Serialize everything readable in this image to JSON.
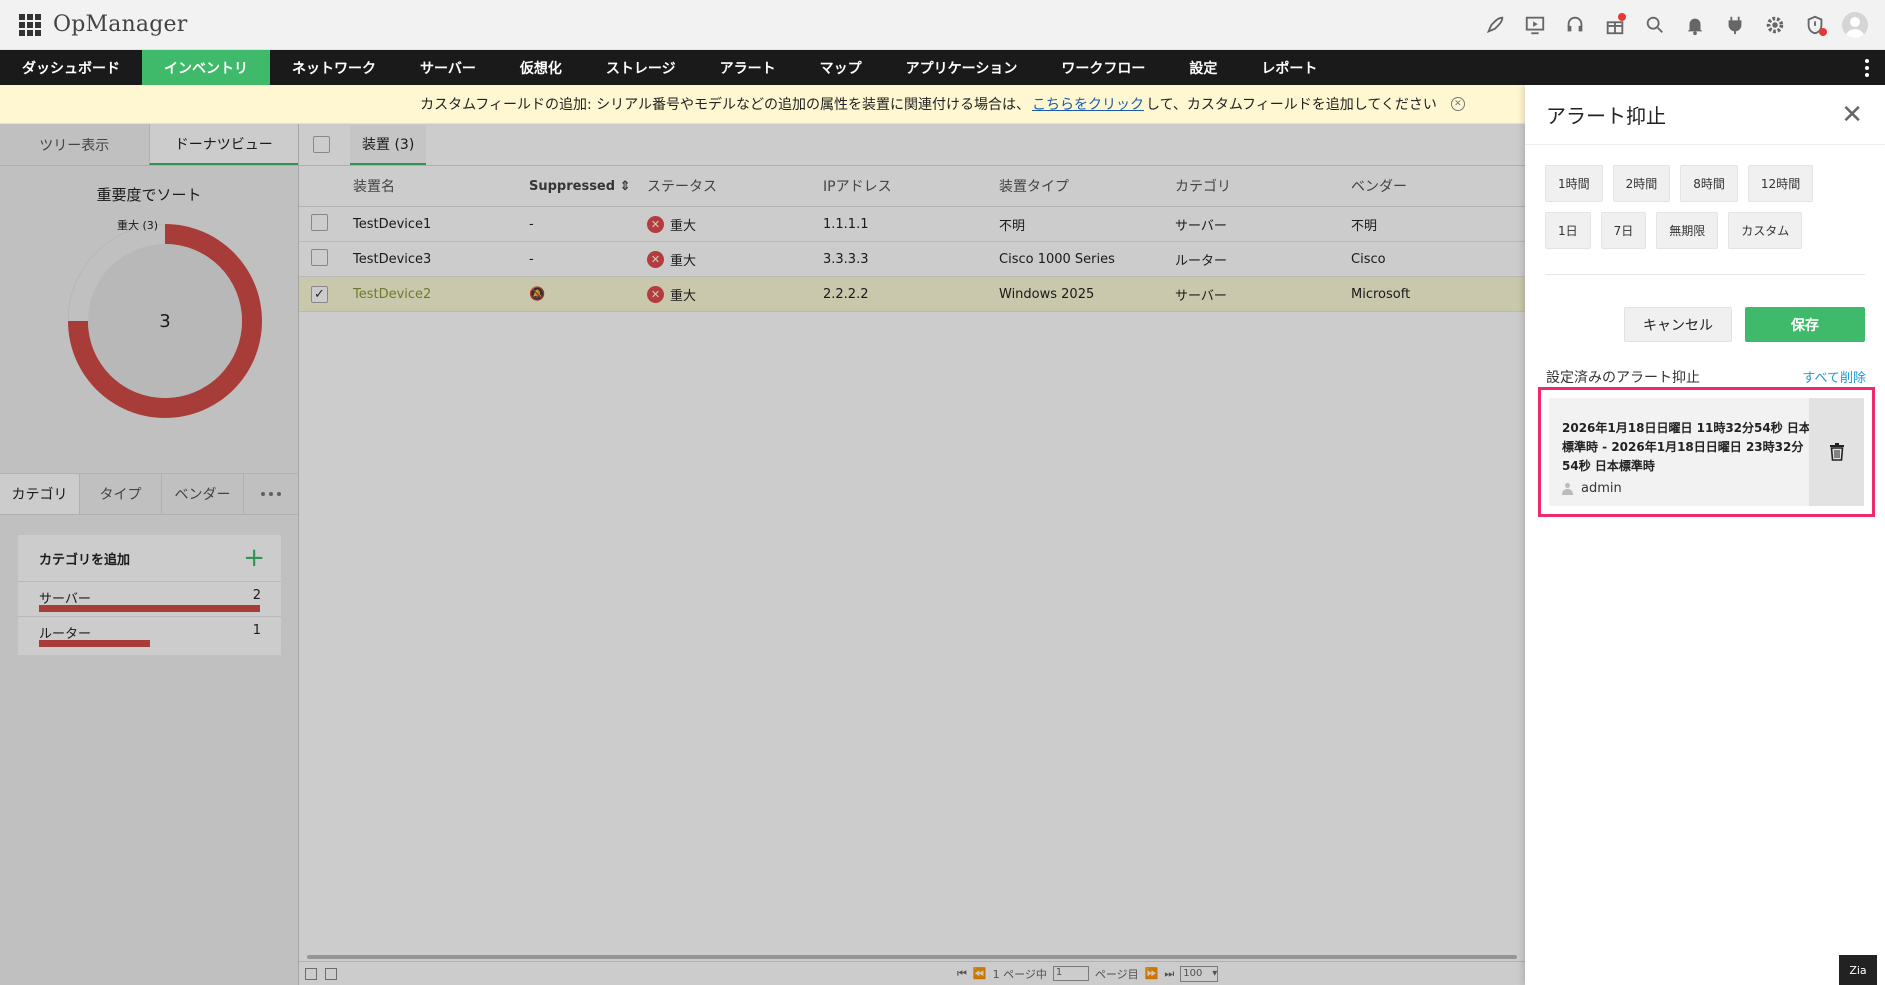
{
  "app": {
    "title": "OpManager"
  },
  "nav": {
    "items": [
      "ダッシュボード",
      "インベントリ",
      "ネットワーク",
      "サーバー",
      "仮想化",
      "ストレージ",
      "アラート",
      "マップ",
      "アプリケーション",
      "ワークフロー",
      "設定",
      "レポート"
    ],
    "active_index": 1
  },
  "banner": {
    "prefix": "カスタムフィールドの追加: シリアル番号やモデルなどの追加の属性を装置に関連付ける場合は、",
    "link": "こちらをクリック",
    "suffix": "して、カスタムフィールドを追加してください"
  },
  "left": {
    "tabs": [
      "ツリー表示",
      "ドーナツビュー"
    ],
    "sort_title": "重要度でソート",
    "donut": {
      "label": "重大 (3)",
      "center": "3",
      "color": "#d24b47"
    },
    "group_tabs": [
      "カテゴリ",
      "タイプ",
      "ベンダー"
    ],
    "add_category": "カテゴリを追加",
    "categories": [
      {
        "name": "サーバー",
        "count": "2",
        "fraction": 1.0
      },
      {
        "name": "ルーター",
        "count": "1",
        "fraction": 0.5
      }
    ]
  },
  "table": {
    "tab_label": "装置 (3)",
    "columns": [
      "装置名",
      "Suppressed",
      "ステータス",
      "IPアドレス",
      "装置タイプ",
      "カテゴリ",
      "ベンダー"
    ],
    "rows": [
      {
        "name": "TestDevice1",
        "suppressed": "-",
        "status": "重大",
        "ip": "1.1.1.1",
        "type": "不明",
        "category": "サーバー",
        "vendor": "不明",
        "selected": false
      },
      {
        "name": "TestDevice3",
        "suppressed": "-",
        "status": "重大",
        "ip": "3.3.3.3",
        "type": "Cisco 1000 Series",
        "category": "ルーター",
        "vendor": "Cisco",
        "selected": false
      },
      {
        "name": "TestDevice2",
        "suppressed": "",
        "status": "重大",
        "ip": "2.2.2.2",
        "type": "Windows 2025",
        "category": "サーバー",
        "vendor": "Microsoft",
        "selected": true
      }
    ],
    "pager": {
      "page_prefix": "1 ページ中",
      "page_value": "1",
      "page_suffix": "ページ目",
      "per_page": "100"
    }
  },
  "drawer": {
    "title": "アラート抑止",
    "durations": [
      "1時間",
      "2時間",
      "8時間",
      "12時間",
      "1日",
      "7日",
      "無期限",
      "カスタム"
    ],
    "cancel": "キャンセル",
    "save": "保存",
    "configured_title": "設定済みのアラート抑止",
    "delete_all": "すべて削除",
    "entry": {
      "range": "2026年1月18日日曜日 11時32分54秒 日本標準時 - 2026年1月18日日曜日 23時32分54秒 日本標準時",
      "user": "admin"
    },
    "zia": "Zia"
  }
}
